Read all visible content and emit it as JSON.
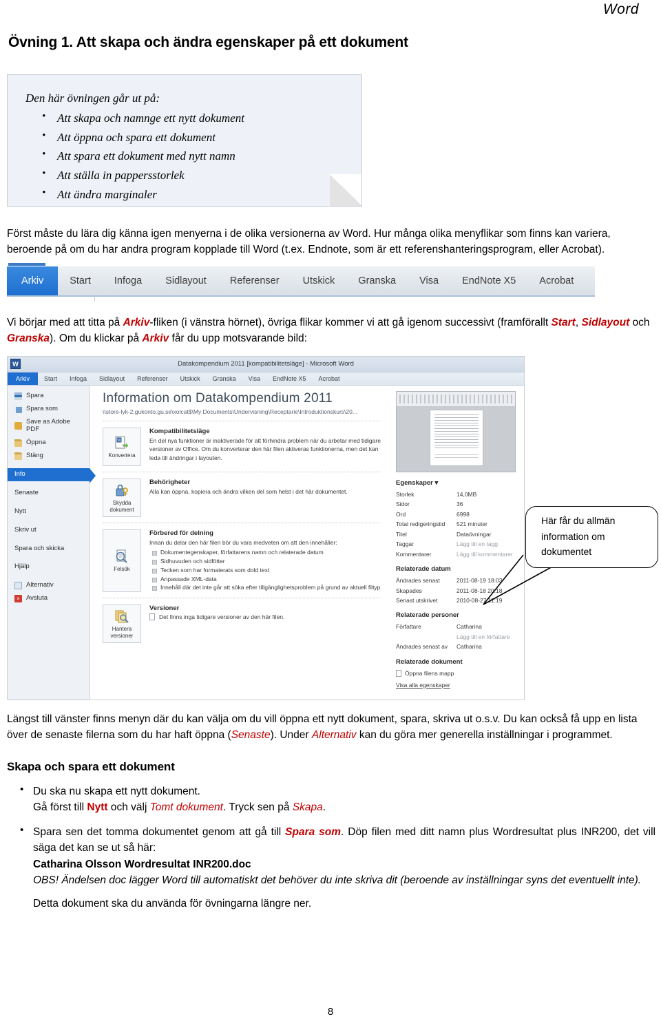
{
  "header": {
    "right_label": "Word"
  },
  "title": "Övning 1. Att skapa och ändra egenskaper på ett dokument",
  "notebox": {
    "intro": "Den här övningen går ut på:",
    "items": [
      "Att skapa och namnge ett nytt dokument",
      "Att öppna och spara ett dokument",
      "Att spara ett dokument med nytt namn",
      "Att ställa in pappersstorlek",
      "Att ändra marginaler"
    ]
  },
  "paragraphs": {
    "intro": "Först måste du lära dig känna igen menyerna i de olika versionerna av Word. Hur många olika menyflikar som finns kan variera, beroende på om du har andra program kopplade till Word (t.ex. Endnote, som är ett referenshanteringsprogram, eller Acrobat).",
    "arkiv_1": "Vi börjar med att titta på ",
    "arkiv_emph1": "Arkiv",
    "arkiv_2": "-fliken (i vänstra hörnet), övriga flikar kommer vi att gå igenom successivt (framförallt ",
    "arkiv_emph2": "Start",
    "arkiv_3": ", ",
    "arkiv_emph3": "Sidlayout",
    "arkiv_4": " och ",
    "arkiv_emph4": "Granska",
    "arkiv_5": "). Om du klickar på ",
    "arkiv_emph5": "Arkiv",
    "arkiv_6": " får du upp motsvarande bild:",
    "langst_1": "Längst till vänster finns menyn där du kan välja om du vill öppna ett nytt dokument, spara, skriva ut o.s.v. Du kan också få upp en lista över de senaste filerna som du har haft öppna (",
    "langst_emph1": "Senaste",
    "langst_2": "). Under ",
    "langst_emph2": "Alternativ",
    "langst_3": " kan du göra mer generella inställningar i programmet."
  },
  "ribbon_strip": {
    "tabs": [
      "Arkiv",
      "Start",
      "Infoga",
      "Sidlayout",
      "Referenser",
      "Utskick",
      "Granska",
      "Visa",
      "EndNote X5",
      "Acrobat"
    ],
    "active": "Arkiv",
    "active_color": "#1f6fd0"
  },
  "backstage": {
    "window_title": "Datakompendium 2011 [kompatibilitetsläge] - Microsoft Word",
    "app_logo": "W",
    "tabs": [
      "Arkiv",
      "Start",
      "Infoga",
      "Sidlayout",
      "Referenser",
      "Utskick",
      "Granska",
      "Visa",
      "EndNote X5",
      "Acrobat"
    ],
    "active_tab": "Arkiv",
    "nav": [
      {
        "label": "Spara",
        "icon": "save-icon"
      },
      {
        "label": "Spara som",
        "icon": "save-as-icon"
      },
      {
        "label": "Save as Adobe PDF",
        "icon": "pdf-icon"
      },
      {
        "label": "Öppna",
        "icon": "open-folder-icon"
      },
      {
        "label": "Stäng",
        "icon": "close-folder-icon"
      },
      {
        "label": "Info",
        "icon": ""
      },
      {
        "label": "Senaste",
        "icon": ""
      },
      {
        "label": "Nytt",
        "icon": ""
      },
      {
        "label": "Skriv ut",
        "icon": ""
      },
      {
        "label": "Spara och skicka",
        "icon": ""
      },
      {
        "label": "Hjälp",
        "icon": ""
      },
      {
        "label": "Alternativ",
        "icon": "options-icon"
      },
      {
        "label": "Avsluta",
        "icon": "exit-icon"
      }
    ],
    "selected_nav": "Info",
    "heading": "Information om Datakompendium 2011",
    "path": "\\\\store-lyk-2.gukonto.gu.se\\xolcat$\\My Documents\\Undervisning\\Receptarie\\Introduktionskurs\\20...",
    "groups": [
      {
        "button_label": "Konvertera",
        "icon": "convert-document-icon",
        "heading": "Kompatibilitetsläge",
        "body": "En del nya funktioner är inaktiverade för att förhindra problem när du arbetar med tidigare versioner av Office. Om du konverterar den här filen aktiveras funktionerna, men det kan leda till ändringar i layouten.",
        "items": []
      },
      {
        "button_label": "Skydda dokument",
        "icon": "lock-key-icon",
        "heading": "Behörigheter",
        "body": "Alla kan öppna, kopiera och ändra vilken del som helst i det här dokumentet.",
        "items": []
      },
      {
        "button_label": "Felsök",
        "icon": "inspect-document-icon",
        "heading": "Förbered för delning",
        "body": "Innan du delar den här filen bör du vara medveten om att den innehåller:",
        "items": [
          "Dokumentegenskaper, författarens namn och relaterade datum",
          "Sidhuvuden och sidfötter",
          "Tecken som har formaterats som dold text",
          "Anpassade XML-data",
          "Innehåll där det inte går att söka efter tillgänglighetsproblem på grund av aktuell filtyp"
        ]
      },
      {
        "button_label": "Hantera versioner",
        "icon": "manage-versions-icon",
        "heading": "Versioner",
        "body": "Det finns inga tidigare versioner av den här filen.",
        "items": []
      }
    ],
    "properties": {
      "heading": "Egenskaper",
      "rows": [
        {
          "key": "Storlek",
          "value": "14,0MB",
          "placeholder": false
        },
        {
          "key": "Sidor",
          "value": "36",
          "placeholder": false
        },
        {
          "key": "Ord",
          "value": "6998",
          "placeholder": false
        },
        {
          "key": "Total redigeringstid",
          "value": "521 minuter",
          "placeholder": false
        },
        {
          "key": "Titel",
          "value": "Dataövningar",
          "placeholder": false
        },
        {
          "key": "Taggar",
          "value": "Lägg till en tagg",
          "placeholder": true
        },
        {
          "key": "Kommentarer",
          "value": "Lägg till kommentarer",
          "placeholder": true
        }
      ],
      "dates_heading": "Relaterade datum",
      "dates": [
        {
          "key": "Ändrades senast",
          "value": "2011-08-19 18:03"
        },
        {
          "key": "Skapades",
          "value": "2011-08-18 20:18"
        },
        {
          "key": "Senast utskrivet",
          "value": "2010-08-27 11:19"
        }
      ],
      "people_heading": "Relaterade personer",
      "people": [
        {
          "key": "Författare",
          "value": "Catharina",
          "placeholder": false
        },
        {
          "key": "",
          "value": "Lägg till en författare",
          "placeholder": true
        },
        {
          "key": "Ändrades senast av",
          "value": "Catharina",
          "placeholder": false
        }
      ],
      "docs_heading": "Relaterade dokument",
      "open_folder_link": "Öppna filens mapp",
      "all_properties_link": "Visa alla egenskaper"
    }
  },
  "callout": {
    "text": "Här får du allmän information om dokumentet"
  },
  "section": {
    "heading": "Skapa och spara ett dokument",
    "bullet1_line1": "Du ska nu skapa ett nytt dokument.",
    "bullet1_line2_a": "Gå först till ",
    "bullet1_nytt": "Nytt",
    "bullet1_line2_b": " och välj ",
    "bullet1_tomt": "Tomt dokument",
    "bullet1_line2_c": ". Tryck sen på ",
    "bullet1_skapa": "Skapa",
    "bullet1_line2_d": ".",
    "bullet2_a": "Spara sen det tomma dokumentet genom att gå till ",
    "bullet2_spara_som": "Spara som",
    "bullet2_b": ". Döp filen med ditt namn plus Wordresultat plus INR200, det vill säga det kan se ut så här:",
    "bullet2_filename": "Catharina Olsson Wordresultat INR200.doc",
    "bullet2_obs": "OBS! Ändelsen doc lägger Word till automatiskt det behöver du inte skriva dit (beroende av inställningar syns det eventuellt inte).",
    "closing": "Detta dokument ska du använda för övningarna längre ner."
  },
  "page_number": "8"
}
